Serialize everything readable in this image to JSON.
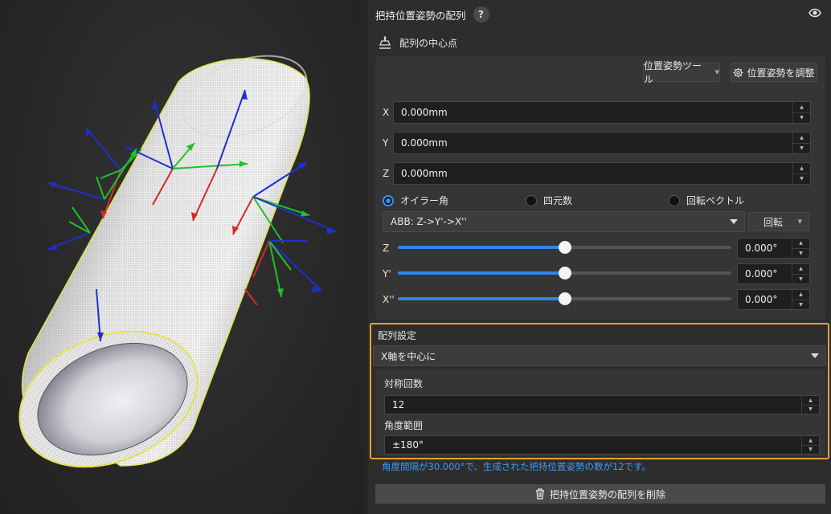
{
  "panel": {
    "title": "把持位置姿勢の配列",
    "help_icon": "?",
    "section_title": "配列の中心点",
    "pose_tool_label": "位置姿勢ツール",
    "adjust_pose_label": "位置姿勢を調整",
    "fields": [
      {
        "label": "X",
        "value": "0.000mm"
      },
      {
        "label": "Y",
        "value": "0.000mm"
      },
      {
        "label": "Z",
        "value": "0.000mm"
      }
    ],
    "rotation_modes": [
      {
        "label": "オイラー角",
        "selected": true
      },
      {
        "label": "四元数",
        "selected": false
      },
      {
        "label": "回転ベクトル",
        "selected": false
      }
    ],
    "euler_convention": "ABB: Z->Y'->X''",
    "rotate_label": "回転",
    "angles": [
      {
        "label": "Z",
        "value": "0.000°",
        "slider_fraction": 0.5
      },
      {
        "label": "Y'",
        "value": "0.000°",
        "slider_fraction": 0.5
      },
      {
        "label": "X''",
        "value": "0.000°",
        "slider_fraction": 0.5
      }
    ],
    "arrangement": {
      "title": "配列設定",
      "mode": "X軸を中心に",
      "symmetry_label": "対称回数",
      "symmetry_value": "12",
      "range_label": "角度範囲",
      "range_value": "±180°"
    },
    "info_text": "角度間隔が30.000°で、生成された把持位置姿勢の数が12です。",
    "delete_label": "把持位置姿勢の配列を削除"
  },
  "colors": {
    "accent": "#2f86e8",
    "highlight_border": "#f0a030",
    "info_text": "#3f9bf5",
    "axis_x": "#d42a2a",
    "axis_y": "#22c02a",
    "axis_z": "#1f2fd0"
  },
  "icons": [
    "eye-icon",
    "pose-center-icon",
    "gear-icon",
    "trash-icon"
  ]
}
